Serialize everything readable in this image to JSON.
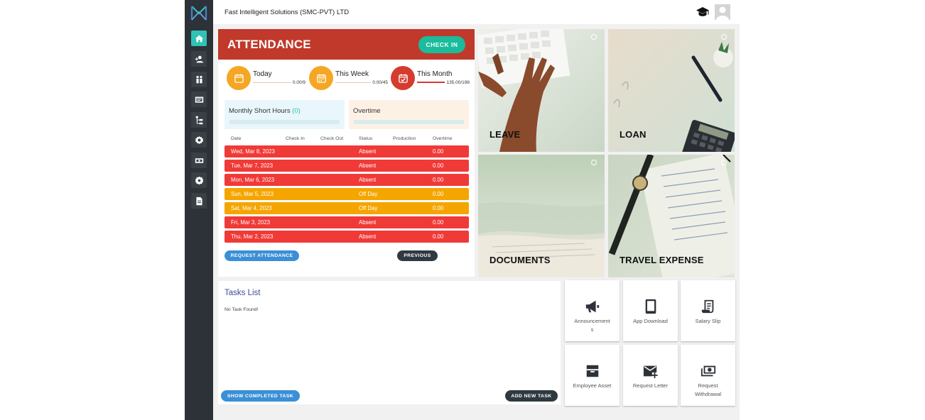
{
  "header": {
    "company": "Fast Intelligent Solutions (SMC-PVT) LTD"
  },
  "sidebar": {
    "items": [
      {
        "icon": "home-icon",
        "active": true
      },
      {
        "icon": "user-add-icon"
      },
      {
        "icon": "people-icon"
      },
      {
        "icon": "id-card-icon"
      },
      {
        "icon": "hierarchy-icon"
      },
      {
        "icon": "gear-icon"
      },
      {
        "icon": "money-icon"
      },
      {
        "icon": "cog-badge-icon"
      },
      {
        "icon": "document-icon"
      }
    ]
  },
  "attendance": {
    "title": "ATTENDANCE",
    "check_in": "CHECK IN",
    "stats": [
      {
        "label": "Today",
        "value": "0.00/9",
        "progress": 0,
        "color": "#f5a623"
      },
      {
        "label": "This Week",
        "value": "0.00/45",
        "progress": 0,
        "color": "#f5a623"
      },
      {
        "label": "This Month",
        "value": "135.00/198",
        "progress": 0.68,
        "color": "#d63b2f"
      }
    ],
    "short_hours_label": "Monthly Short Hours",
    "short_hours_count": "(0)",
    "overtime_label": "Overtime",
    "columns": [
      "Date",
      "Check In",
      "Check Out",
      "Status",
      "Production",
      "Overtime"
    ],
    "rows": [
      {
        "date": "Wed, Mar 8, 2023",
        "check_in": "",
        "check_out": "",
        "status": "Absent",
        "production": "",
        "overtime": "0.00",
        "color": "#f03a37"
      },
      {
        "date": "Tue, Mar 7, 2023",
        "check_in": "",
        "check_out": "",
        "status": "Absent",
        "production": "",
        "overtime": "0.00",
        "color": "#f03a37"
      },
      {
        "date": "Mon, Mar 6, 2023",
        "check_in": "",
        "check_out": "",
        "status": "Absent",
        "production": "",
        "overtime": "0.00",
        "color": "#f03a37"
      },
      {
        "date": "Sun, Mar 5, 2023",
        "check_in": "",
        "check_out": "",
        "status": "Off Day",
        "production": "",
        "overtime": "0.00",
        "color": "#f5a500"
      },
      {
        "date": "Sat, Mar 4, 2023",
        "check_in": "",
        "check_out": "",
        "status": "Off Day",
        "production": "",
        "overtime": "0.00",
        "color": "#f5a500"
      },
      {
        "date": "Fri, Mar 3, 2023",
        "check_in": "",
        "check_out": "",
        "status": "Absent",
        "production": "",
        "overtime": "0.00",
        "color": "#f03a37"
      },
      {
        "date": "Thu, Mar 2, 2023",
        "check_in": "",
        "check_out": "",
        "status": "Absent",
        "production": "",
        "overtime": "0.00",
        "color": "#f03a37"
      }
    ],
    "request_button": "REQUEST ATTENDANCE",
    "previous_button": "PREVIOUS"
  },
  "tiles": [
    {
      "label": "LEAVE"
    },
    {
      "label": "LOAN"
    },
    {
      "label": "DOCUMENTS"
    },
    {
      "label": "TRAVEL EXPENSE"
    }
  ],
  "tasks": {
    "title": "Tasks List",
    "empty": "No Task Found!",
    "show_completed": "SHOW COMPLETED TASK",
    "add_new": "ADD NEW TASK"
  },
  "quick_links": [
    {
      "label": "Announcements",
      "icon": "megaphone-icon"
    },
    {
      "label": "App Download",
      "icon": "phone-icon"
    },
    {
      "label": "Salary Slip",
      "icon": "receipt-icon"
    },
    {
      "label": "Employee Asset",
      "icon": "asset-box-icon"
    },
    {
      "label": "Request Letter",
      "icon": "mail-add-icon"
    },
    {
      "label": "Request Withdrawal",
      "icon": "cash-icon"
    }
  ],
  "colors": {
    "accent": "#2fc3b3",
    "sidebar": "#2d3238",
    "banner": "#c0392b",
    "blue_button": "#3a8fd6",
    "dark_button": "#2f3a40"
  }
}
